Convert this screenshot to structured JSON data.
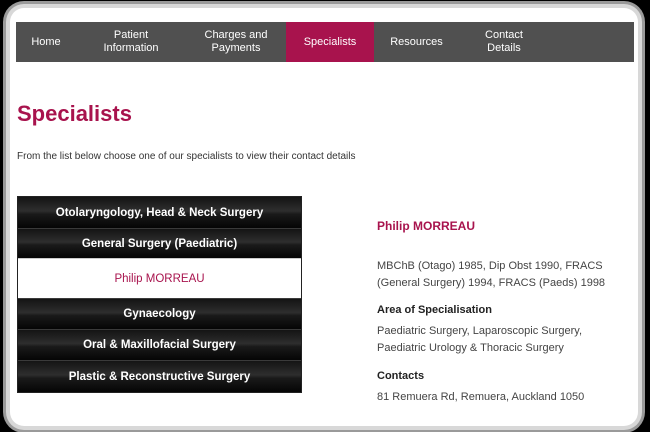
{
  "nav": {
    "items": [
      {
        "label": "Home"
      },
      {
        "label": "Patient\nInformation"
      },
      {
        "label": "Charges and\nPayments"
      },
      {
        "label": "Specialists"
      },
      {
        "label": "Resources"
      },
      {
        "label": "Contact\nDetails"
      }
    ],
    "active_index": 3
  },
  "page": {
    "title": "Specialists",
    "intro": "From the list below choose one of our specialists to view their contact details"
  },
  "specialists": {
    "items": [
      {
        "label": "Otolaryngology, Head & Neck Surgery"
      },
      {
        "label": "General Surgery (Paediatric)"
      },
      {
        "label": "Philip MORREAU"
      },
      {
        "label": "Gynaecology"
      },
      {
        "label": "Oral & Maxillofacial Surgery"
      },
      {
        "label": "Plastic & Reconstructive Surgery"
      }
    ],
    "selected_index": 2
  },
  "detail": {
    "name": "Philip MORREAU",
    "qualifications_line1": "MBChB (Otago) 1985, Dip Obst 1990, FRACS",
    "qualifications_line2": "(General Surgery) 1994, FRACS (Paeds) 1998",
    "area_heading": "Area of Specialisation",
    "area_line1": "Paediatric Surgery, Laparoscopic Surgery,",
    "area_line2": "Paediatric Urology & Thoracic Surgery",
    "contacts_heading": "Contacts",
    "address": "81 Remuera Rd, Remuera, Auckland 1050"
  },
  "colors": {
    "accent": "#a8134d",
    "nav_bg": "#505050"
  }
}
